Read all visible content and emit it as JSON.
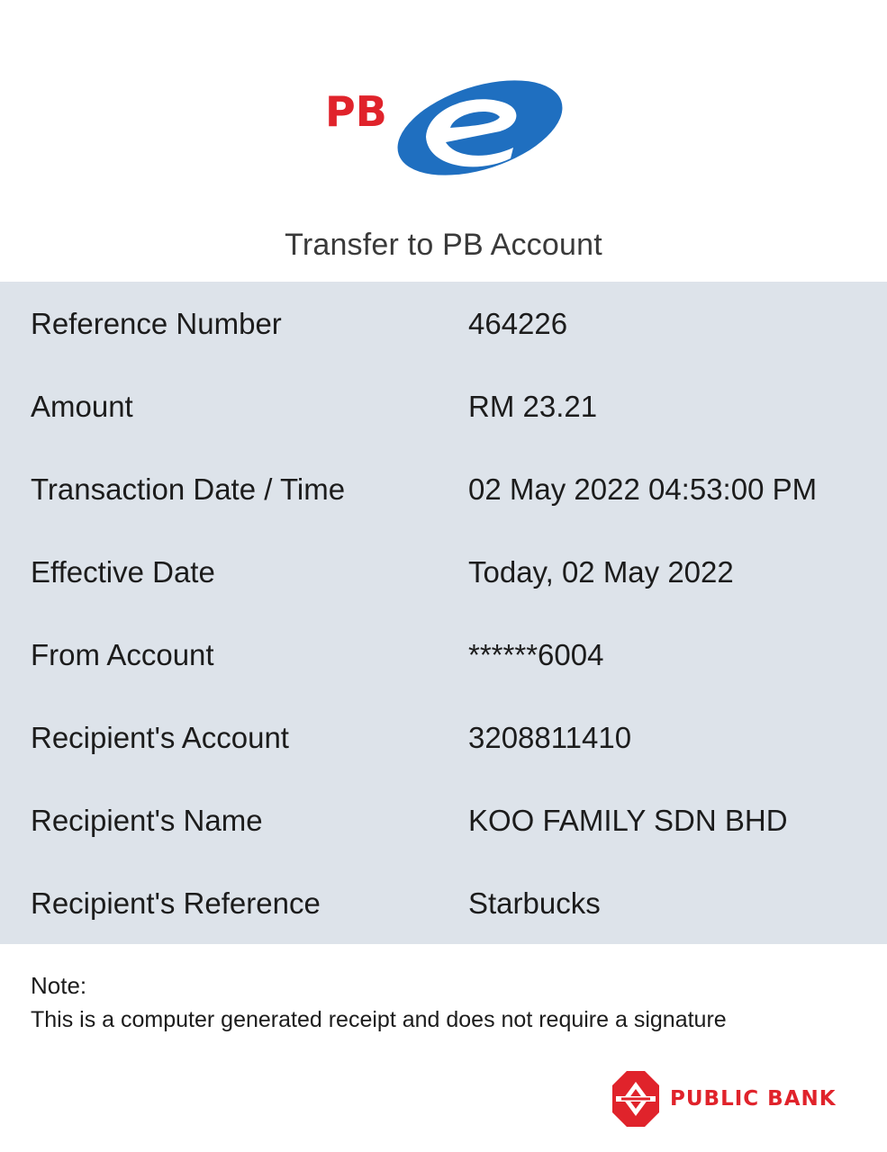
{
  "brand": {
    "logo_text": "PB",
    "logo_letter": "e",
    "colors": {
      "red": "#e0232b",
      "blue": "#1f6fc0",
      "panel": "#dde3ea"
    },
    "bank_name": "PUBLIC BANK"
  },
  "page": {
    "title": "Transfer to PB Account"
  },
  "details": [
    {
      "label": "Reference Number",
      "value": "464226"
    },
    {
      "label": "Amount",
      "value": "RM 23.21"
    },
    {
      "label": "Transaction Date / Time",
      "value": "02 May 2022 04:53:00 PM"
    },
    {
      "label": "Effective Date",
      "value": "Today, 02 May 2022"
    },
    {
      "label": "From Account",
      "value": "******6004"
    },
    {
      "label": "Recipient's Account",
      "value": "3208811410"
    },
    {
      "label": "Recipient's Name",
      "value": "KOO FAMILY SDN BHD"
    },
    {
      "label": "Recipient's Reference",
      "value": "Starbucks"
    }
  ],
  "note": {
    "title": "Note:",
    "text": "This is a computer generated receipt and does not require a signature"
  }
}
